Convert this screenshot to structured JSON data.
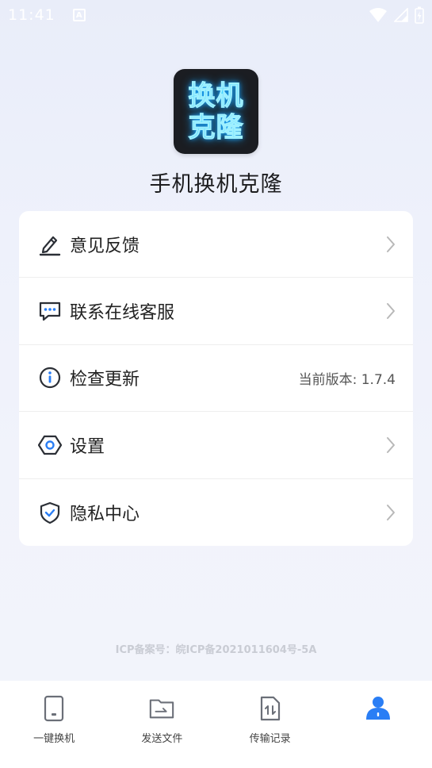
{
  "status_bar": {
    "time": "11:41",
    "notification_icon": "a-icon",
    "icons": [
      "wifi-icon",
      "signal-icon",
      "battery-charging-icon"
    ]
  },
  "header": {
    "logo_lines": [
      "换机",
      "克隆"
    ],
    "app_name": "手机换机克隆"
  },
  "menu": {
    "items": [
      {
        "label": "意见反馈",
        "icon": "edit-pen-icon",
        "value": "",
        "arrow": true
      },
      {
        "label": "联系在线客服",
        "icon": "chat-icon",
        "value": "",
        "arrow": true
      },
      {
        "label": "检查更新",
        "icon": "info-icon",
        "value": "当前版本: 1.7.4",
        "arrow": false
      },
      {
        "label": "设置",
        "icon": "settings-hex-icon",
        "value": "",
        "arrow": true
      },
      {
        "label": "隐私中心",
        "icon": "shield-check-icon",
        "value": "",
        "arrow": true
      }
    ]
  },
  "footer": {
    "icp": "ICP备案号：皖ICP备2021011604号-5A"
  },
  "tab_bar": {
    "tabs": [
      {
        "label": "一键换机",
        "icon": "phone-icon",
        "active": false
      },
      {
        "label": "发送文件",
        "icon": "folder-send-icon",
        "active": false
      },
      {
        "label": "传输记录",
        "icon": "transfer-record-icon",
        "active": false
      },
      {
        "label": "",
        "icon": "user-icon",
        "active": true
      }
    ]
  },
  "colors": {
    "accent": "#2a7ef5",
    "icon_dark": "#2b2f36",
    "arrow": "#b8b8b8",
    "logo_bg": "#1b1d22",
    "logo_text": "#49d3ff"
  }
}
